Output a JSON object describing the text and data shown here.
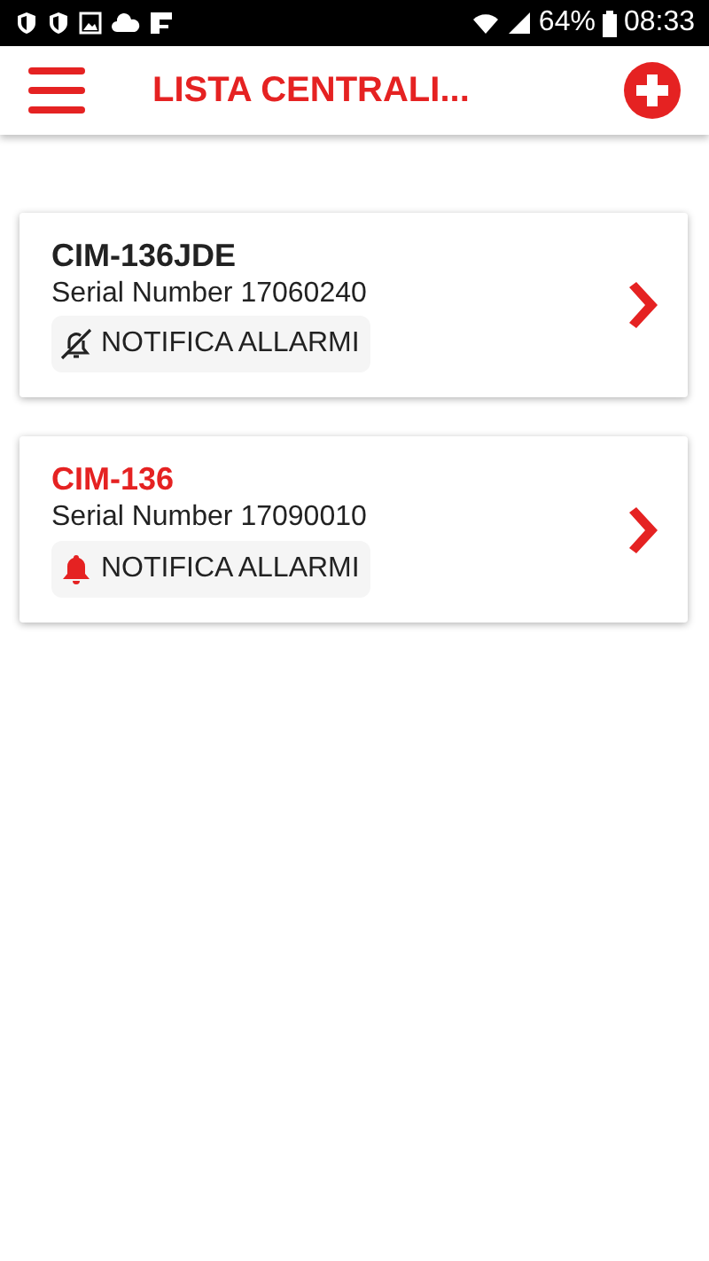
{
  "status_bar": {
    "battery": "64%",
    "time": "08:33"
  },
  "app_bar": {
    "title": "LISTA CENTRALI..."
  },
  "devices": [
    {
      "name": "CIM-136JDE",
      "serial": "Serial Number 17060240",
      "notify_label": "NOTIFICA ALLARMI",
      "notifications_on": false,
      "selected": false
    },
    {
      "name": "CIM-136",
      "serial": "Serial Number 17090010",
      "notify_label": "NOTIFICA ALLARMI",
      "notifications_on": true,
      "selected": true
    }
  ]
}
